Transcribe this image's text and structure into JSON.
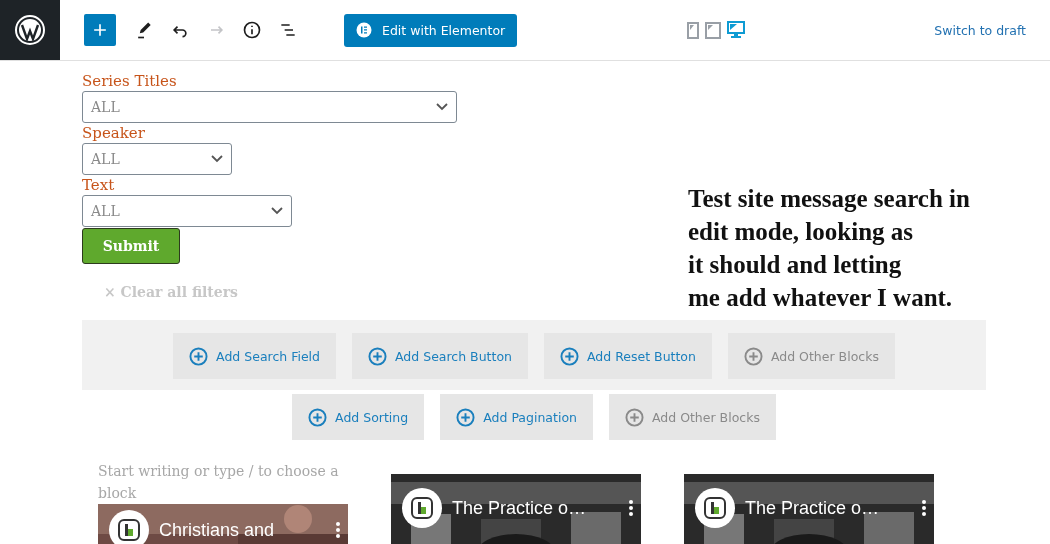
{
  "toolbar": {
    "tools": [
      {
        "kind": "add",
        "disabled": false
      },
      {
        "kind": "pen",
        "disabled": false
      },
      {
        "kind": "undo",
        "disabled": false
      },
      {
        "kind": "redo",
        "disabled": true
      },
      {
        "kind": "info",
        "disabled": false
      },
      {
        "kind": "outline",
        "disabled": false
      }
    ],
    "elementor_button": "Edit with Elementor",
    "devices": [
      {
        "kind": "mobile",
        "selected": false
      },
      {
        "kind": "tablet",
        "selected": false
      },
      {
        "kind": "desktop",
        "selected": true
      }
    ],
    "switch_link": "Switch to draft"
  },
  "filters": [
    {
      "label": "Series Titles",
      "value": "ALL"
    },
    {
      "label": "Speaker",
      "value": "ALL"
    },
    {
      "label": "Text",
      "value": "ALL"
    }
  ],
  "submit": "Submit",
  "clear": "× Clear all filters",
  "note": [
    "Test site message search in",
    "edit mode, looking as",
    "it should and letting",
    "me add whatever I want."
  ],
  "block_rows": [
    {
      "shaded": true,
      "buttons": [
        {
          "label": "Add Search Field",
          "disabled": false
        },
        {
          "label": "Add Search Button",
          "disabled": false
        },
        {
          "label": "Add Reset Button",
          "disabled": false
        },
        {
          "label": "Add Other Blocks",
          "disabled": true
        }
      ]
    },
    {
      "shaded": false,
      "buttons": [
        {
          "label": "Add Sorting",
          "disabled": false
        },
        {
          "label": "Add Pagination",
          "disabled": false
        },
        {
          "label": "Add Other Blocks",
          "disabled": true
        }
      ]
    }
  ],
  "placeholder": "Start writing or type / to choose a block",
  "videos": [
    {
      "title": "Christians and",
      "kind": "picture"
    },
    {
      "title": "The Practice o…",
      "kind": "picture"
    },
    {
      "title": "The Practice o…",
      "kind": "picture"
    }
  ]
}
